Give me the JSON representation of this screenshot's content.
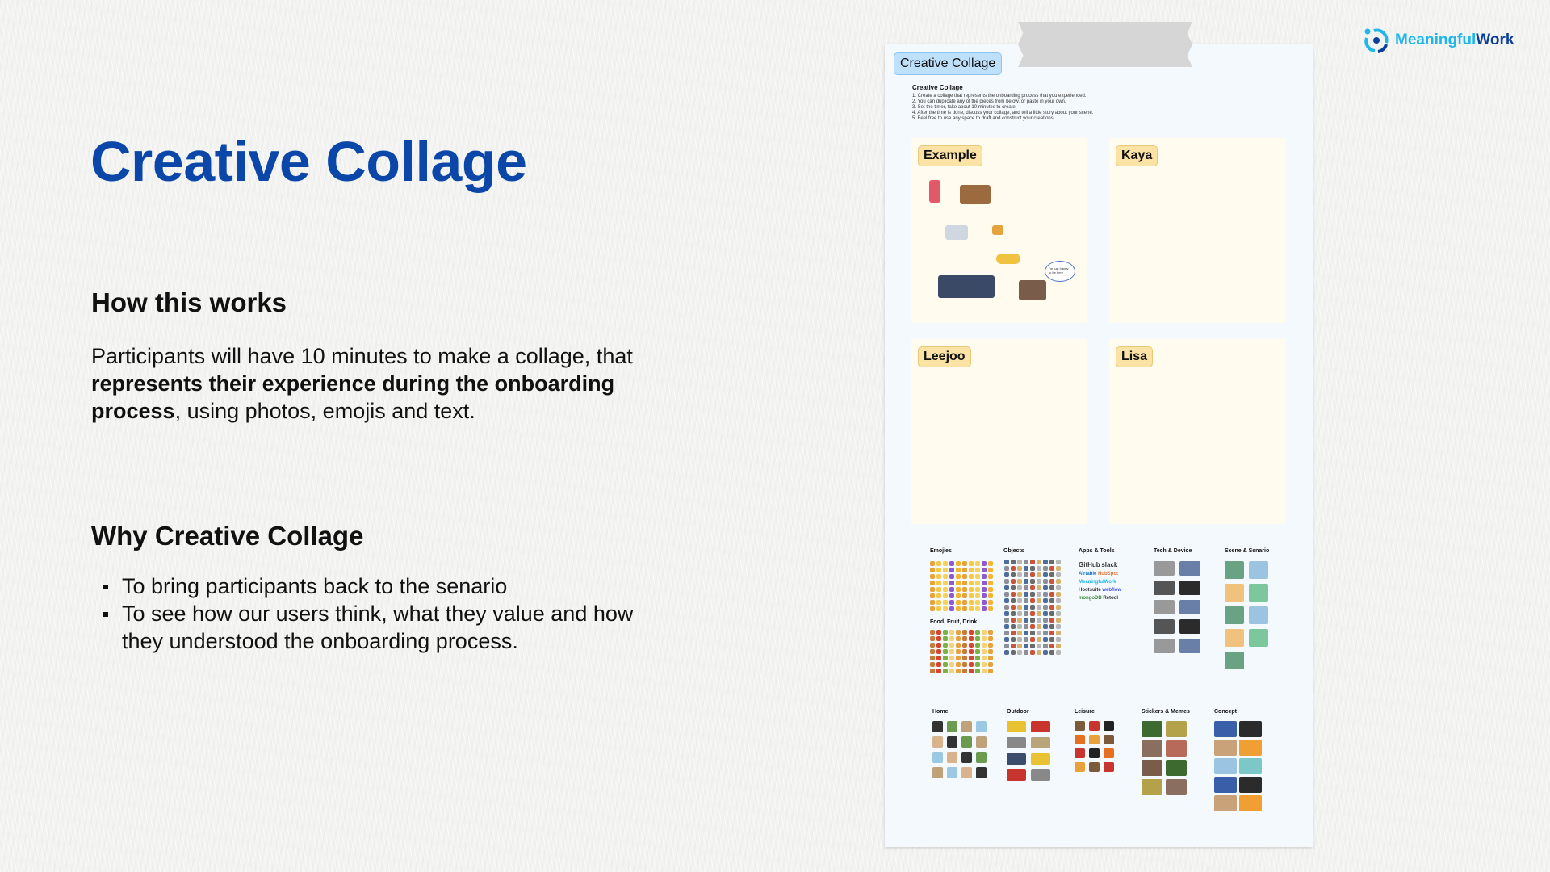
{
  "slide": {
    "title": "Creative Collage",
    "how": {
      "heading": "How this works",
      "body": [
        {
          "text": "Participants will have 10 minutes to make a collage, that ",
          "bold": false
        },
        {
          "text": "represents their experience during the onboarding process",
          "bold": true
        },
        {
          "text": ", using photos, emojis and text.",
          "bold": false
        }
      ]
    },
    "why": {
      "heading": "Why Creative Collage",
      "bullets": [
        "To bring participants back to the senario",
        "To see how our users think, what they value and how they understood the onboarding process."
      ]
    }
  },
  "logo": {
    "part1": "Meaningful",
    "part2": "Work",
    "colors": {
      "light": "#1fb6ea",
      "dark": "#0b3f99"
    }
  },
  "board": {
    "label": "Creative Collage",
    "instructions": {
      "title": "Creative Collage",
      "steps": [
        "Create a collage that represents the onboarding process that you experienced.",
        "You can duplicate any of the pieces from below, or paste in your own.",
        "Set the timer, take about 10 minutes to create.",
        "After the time is done, discuss your collage, and tell a little story about your scene.",
        "Feel free to use any space to draft and construct your creations."
      ]
    },
    "cards": [
      {
        "label": "Example"
      },
      {
        "label": "Kaya"
      },
      {
        "label": "Leejoo"
      },
      {
        "label": "Lisa"
      }
    ],
    "example_bubble": "I'm just happy to be here",
    "categories": [
      "Emojies",
      "Food, Fruit, Drink",
      "Objects",
      "Apps & Tools",
      "Tech & Device",
      "Scene & Senario",
      "Home",
      "Outdoor",
      "Leisure",
      "Stickers & Memes",
      "Concept"
    ],
    "apps": [
      "GitHub",
      "slack",
      "Airtable",
      "HubSpot",
      "MeaningfulWork",
      "Hootsuite",
      "webflow",
      "mongoDB",
      "Retool"
    ]
  },
  "colors": {
    "title": "#0b47a8",
    "board_label": "#bfe0fb",
    "card_label": "#fbe3a5",
    "card_bg": "#fffcef"
  }
}
